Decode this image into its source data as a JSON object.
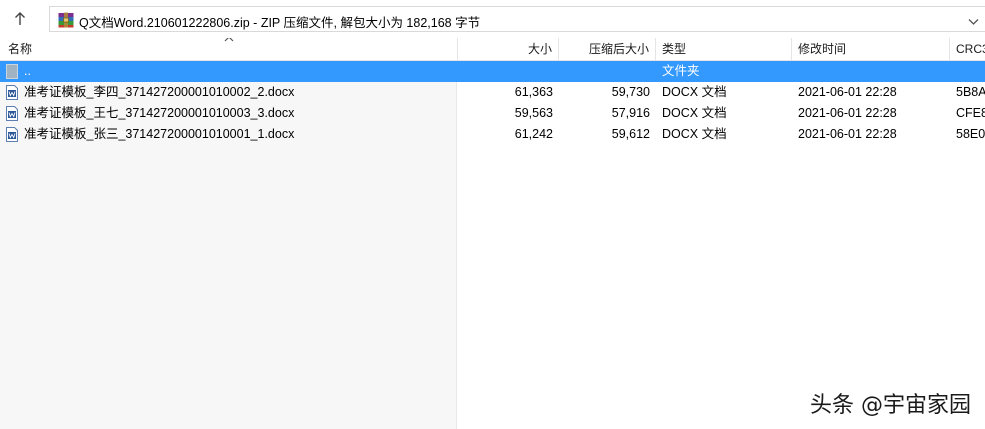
{
  "address": {
    "path": "Q文档Word.210601222806.zip - ZIP 压缩文件, 解包大小为 182,168 字节"
  },
  "columns": {
    "name": "名称",
    "size": "大小",
    "packed": "压缩后大小",
    "type": "类型",
    "modified": "修改时间",
    "crc": "CRC3"
  },
  "parent_row": {
    "name": "..",
    "type": "文件夹"
  },
  "files": [
    {
      "name": "准考证模板_李四_371427200001010002_2.docx",
      "size": "61,363",
      "packed": "59,730",
      "type": "DOCX 文档",
      "modified": "2021-06-01 22:28",
      "crc": "5B8A"
    },
    {
      "name": "准考证模板_王七_371427200001010003_3.docx",
      "size": "59,563",
      "packed": "57,916",
      "type": "DOCX 文档",
      "modified": "2021-06-01 22:28",
      "crc": "CFE8"
    },
    {
      "name": "准考证模板_张三_371427200001010001_1.docx",
      "size": "61,242",
      "packed": "59,612",
      "type": "DOCX 文档",
      "modified": "2021-06-01 22:28",
      "crc": "58E0"
    }
  ],
  "watermark": "头条 @宇宙家园",
  "colors": {
    "selection": "#3399ff",
    "name_column_bg": "#f7f7f7"
  }
}
